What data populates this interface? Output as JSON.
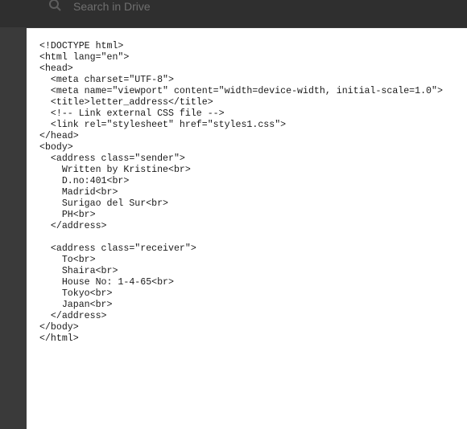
{
  "search": {
    "placeholder": "Search in Drive",
    "icon": "search-icon"
  },
  "document": {
    "lines": [
      "<!DOCTYPE html>",
      "<html lang=\"en\">",
      "<head>",
      "  <meta charset=\"UTF-8\">",
      "  <meta name=\"viewport\" content=\"width=device-width, initial-scale=1.0\">",
      "  <title>letter_address</title>",
      "  <!-- Link external CSS file -->",
      "  <link rel=\"stylesheet\" href=\"styles1.css\">",
      "</head>",
      "<body>",
      "  <address class=\"sender\">",
      "    Written by Kristine<br>",
      "    D.no:401<br>",
      "    Madrid<br>",
      "    Surigao del Sur<br>",
      "    PH<br>",
      "  </address>",
      "",
      "  <address class=\"receiver\">",
      "    To<br>",
      "    Shaira<br>",
      "    House No: 1-4-65<br>",
      "    Tokyo<br>",
      "    Japan<br>",
      "  </address>",
      "</body>",
      "</html>"
    ]
  }
}
